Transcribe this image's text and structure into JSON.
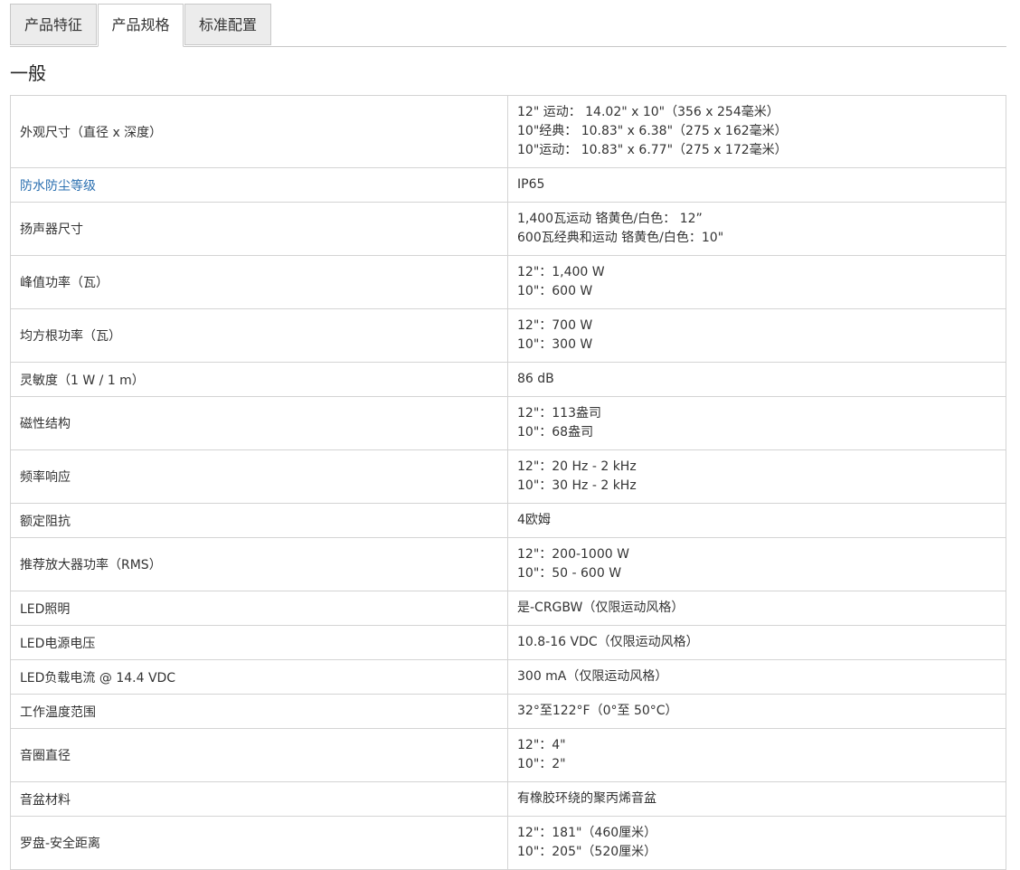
{
  "tabs": [
    {
      "label": "产品特征"
    },
    {
      "label": "产品规格"
    },
    {
      "label": "标准配置"
    }
  ],
  "section": {
    "title": "一般"
  },
  "rows": [
    {
      "label": "外观尺寸（直径 x 深度）",
      "values": [
        "12\" 运动： 14.02\" x 10\"（356 x 254毫米）",
        "10\"经典： 10.83\" x 6.38\"（275 x 162毫米）",
        "10\"运动： 10.83\" x 6.77\"（275 x 172毫米）"
      ]
    },
    {
      "label": "防水防尘等级",
      "values": [
        "IP65"
      ]
    },
    {
      "label": "扬声器尺寸",
      "values": [
        "1,400瓦运动 铬黄色/白色： 12”",
        "600瓦经典和运动 铬黄色/白色：10\""
      ]
    },
    {
      "label": "峰值功率（瓦）",
      "values": [
        "12\"：1,400 W",
        "10\"：600 W"
      ]
    },
    {
      "label": "均方根功率（瓦）",
      "values": [
        "12\"：700 W",
        "10\"：300 W"
      ]
    },
    {
      "label": "灵敏度（1 W / 1 m）",
      "values": [
        "86 dB"
      ]
    },
    {
      "label": "磁性结构",
      "values": [
        "12\"：113盎司",
        "10\"：68盎司"
      ]
    },
    {
      "label": "频率响应",
      "values": [
        "12\"：20 Hz - 2 kHz",
        "10\"：30 Hz - 2 kHz"
      ]
    },
    {
      "label": "额定阻抗",
      "values": [
        "4欧姆"
      ]
    },
    {
      "label": "推荐放大器功率（RMS）",
      "values": [
        "12\"：200-1000 W",
        "10\"：50 - 600 W"
      ]
    },
    {
      "label": "LED照明",
      "values": [
        "是-CRGBW（仅限运动风格）"
      ]
    },
    {
      "label": "LED电源电压",
      "values": [
        "10.8-16 VDC（仅限运动风格）"
      ]
    },
    {
      "label": "LED负载电流 @ 14.4 VDC",
      "values": [
        "300 mA（仅限运动风格）"
      ]
    },
    {
      "label": "工作温度范围",
      "values": [
        "32°至122°F（0°至 50°C）"
      ]
    },
    {
      "label": "音圈直径",
      "values": [
        "12\"：4\"",
        "10\"：2\""
      ]
    },
    {
      "label": "音盆材料",
      "values": [
        "有橡胶环绕的聚丙烯音盆"
      ]
    },
    {
      "label": "罗盘-安全距离",
      "values": [
        "12\"：181\"（460厘米）",
        "10\"：205\"（520厘米）"
      ]
    }
  ]
}
